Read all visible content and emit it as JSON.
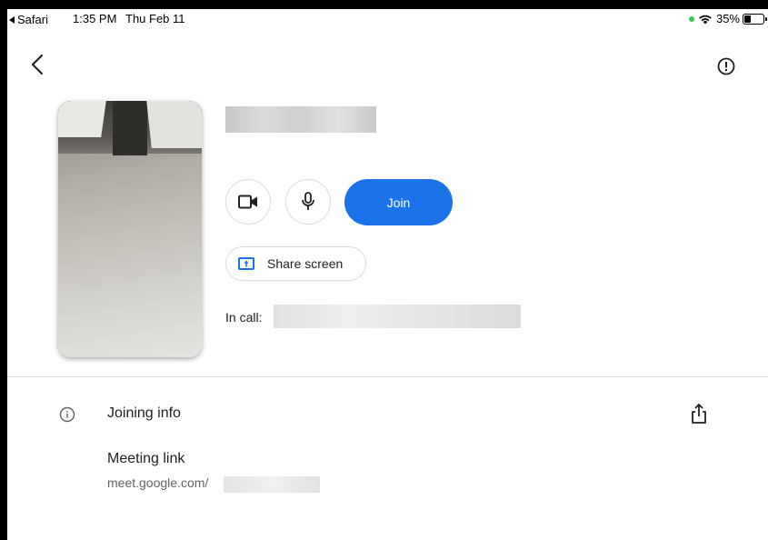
{
  "status_bar": {
    "back_app": "Safari",
    "time": "1:35 PM",
    "date": "Thu Feb 11",
    "battery": "35%"
  },
  "icons": {
    "back": "chevron-left-icon",
    "report": "alert-circle-icon",
    "camera": "video-camera-icon",
    "mic": "microphone-icon",
    "share_screen": "present-screen-icon",
    "info": "info-icon",
    "share_out": "share-icon"
  },
  "colors": {
    "accent": "#1a73e8",
    "border": "#dadce0",
    "text": "#202124",
    "muted": "#5f6368",
    "status_dot": "#34c759"
  },
  "main": {
    "join_label": "Join",
    "share_label": "Share screen",
    "in_call_label": "In call:"
  },
  "joining_info": {
    "title": "Joining info",
    "link_title": "Meeting link",
    "link_prefix": "meet.google.com/"
  }
}
